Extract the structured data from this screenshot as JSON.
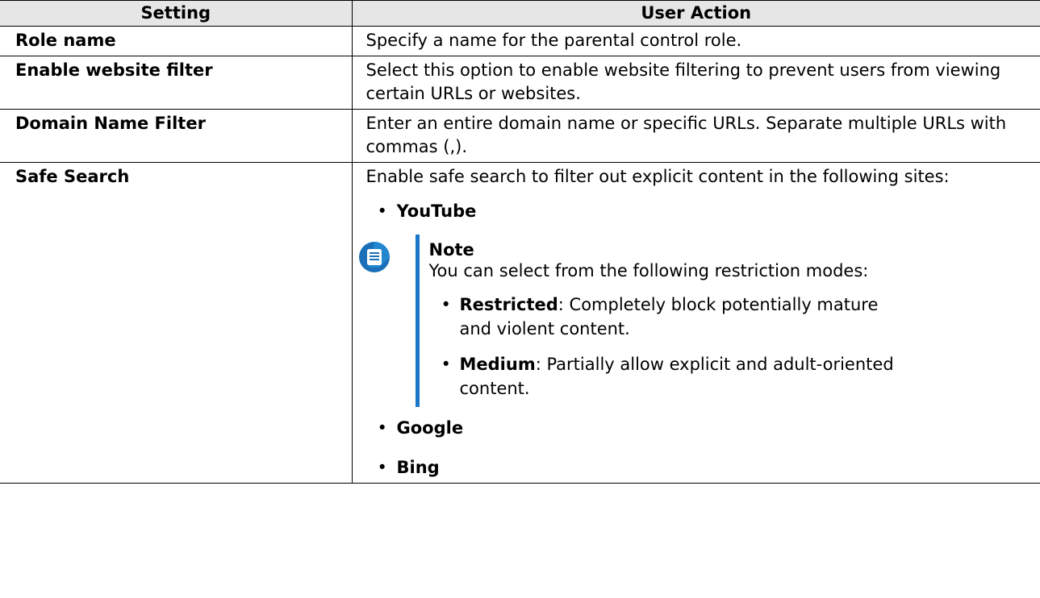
{
  "table": {
    "headers": [
      "Setting",
      "User Action"
    ],
    "rows": [
      {
        "setting": "Role name",
        "action": "Specify a name for the parental control role."
      },
      {
        "setting": "Enable website filter",
        "action": "Select this option to enable website filtering to prevent users from viewing certain URLs or websites."
      },
      {
        "setting": "Domain Name Filter",
        "action": "Enter an entire domain name or specific URLs. Separate multiple URLs with commas (,)."
      },
      {
        "setting": "Safe Search",
        "action": "Enable safe search to filter out explicit content in the following sites:"
      }
    ]
  },
  "safe_search": {
    "sites": [
      "YouTube",
      "Google",
      "Bing"
    ],
    "note": {
      "title": "Note",
      "intro": "You can select from the following restriction modes:",
      "modes": [
        {
          "name": "Restricted",
          "desc": ": Completely block potentially mature and violent content."
        },
        {
          "name": "Medium",
          "desc": ": Partially allow explicit and adult-oriented content."
        }
      ]
    }
  },
  "icons": {
    "note": "note-icon"
  },
  "colors": {
    "note_accent": "#1976c8",
    "header_bg": "#e6e6e6",
    "border": "#000000"
  }
}
